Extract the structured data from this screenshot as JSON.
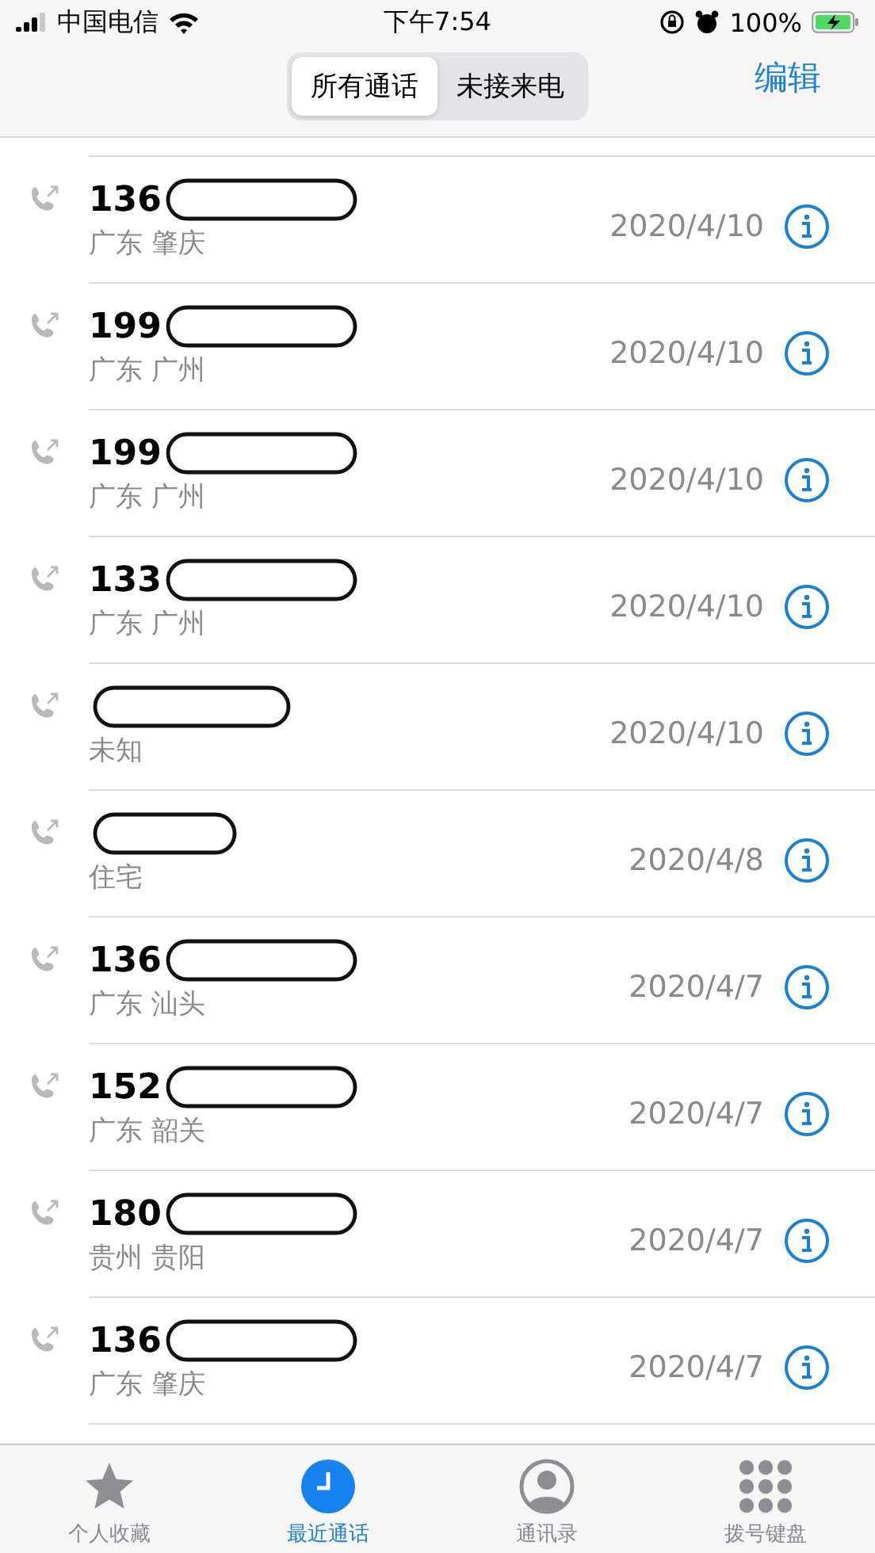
{
  "status_bar": {
    "carrier": "中国电信",
    "time": "下午7:54",
    "battery": "100%"
  },
  "nav": {
    "segments": [
      {
        "label": "所有通话",
        "selected": true
      },
      {
        "label": "未接来电",
        "selected": false
      }
    ],
    "edit": "编辑"
  },
  "calls": [
    {
      "number": "136",
      "redacted": true,
      "location": "广东 肇庆",
      "date": "2020/4/10"
    },
    {
      "number": "199",
      "redacted": true,
      "location": "广东 广州",
      "date": "2020/4/10"
    },
    {
      "number": "199",
      "redacted": true,
      "location": "广东 广州",
      "date": "2020/4/10"
    },
    {
      "number": "133",
      "redacted": true,
      "location": "广东 广州",
      "date": "2020/4/10"
    },
    {
      "redacted": true,
      "location": "未知",
      "date": "2020/4/10"
    },
    {
      "redacted": true,
      "location": "住宅",
      "date": "2020/4/8"
    },
    {
      "number": "136",
      "redacted": true,
      "location": "广东 汕头",
      "date": "2020/4/7"
    },
    {
      "number": "152",
      "redacted": true,
      "location": "广东 韶关",
      "date": "2020/4/7"
    },
    {
      "number": "180",
      "redacted": true,
      "location": "贵州 贵阳",
      "date": "2020/4/7"
    },
    {
      "number": "136",
      "redacted": true,
      "location": "广东 肇庆",
      "date": "2020/4/7"
    }
  ],
  "tab_bar": [
    {
      "kind": "favorites",
      "label": "个人收藏",
      "selected": false
    },
    {
      "kind": "recents",
      "label": "最近通话",
      "selected": true
    },
    {
      "kind": "contacts",
      "label": "通讯录",
      "selected": false
    },
    {
      "kind": "keypad",
      "label": "拨号键盘",
      "selected": false
    }
  ]
}
